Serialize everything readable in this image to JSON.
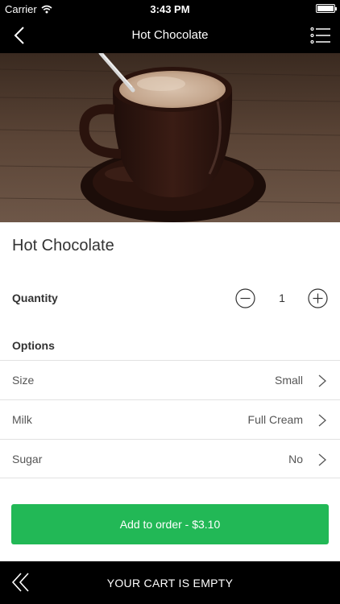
{
  "status_bar": {
    "carrier": "Carrier",
    "time": "3:43 PM"
  },
  "nav": {
    "title": "Hot Chocolate",
    "back_icon": "chevron-left-icon",
    "menu_icon": "list-menu-icon"
  },
  "product": {
    "image": "hot-chocolate-photo",
    "name": "Hot Chocolate"
  },
  "quantity": {
    "label": "Quantity",
    "value": "1"
  },
  "options": {
    "header": "Options",
    "items": [
      {
        "name": "Size",
        "value": "Small"
      },
      {
        "name": "Milk",
        "value": "Full Cream"
      },
      {
        "name": "Sugar",
        "value": "No"
      }
    ]
  },
  "add_button": {
    "label": "Add to order - $3.10",
    "color": "#22b856"
  },
  "cart": {
    "label": "YOUR CART IS EMPTY"
  }
}
